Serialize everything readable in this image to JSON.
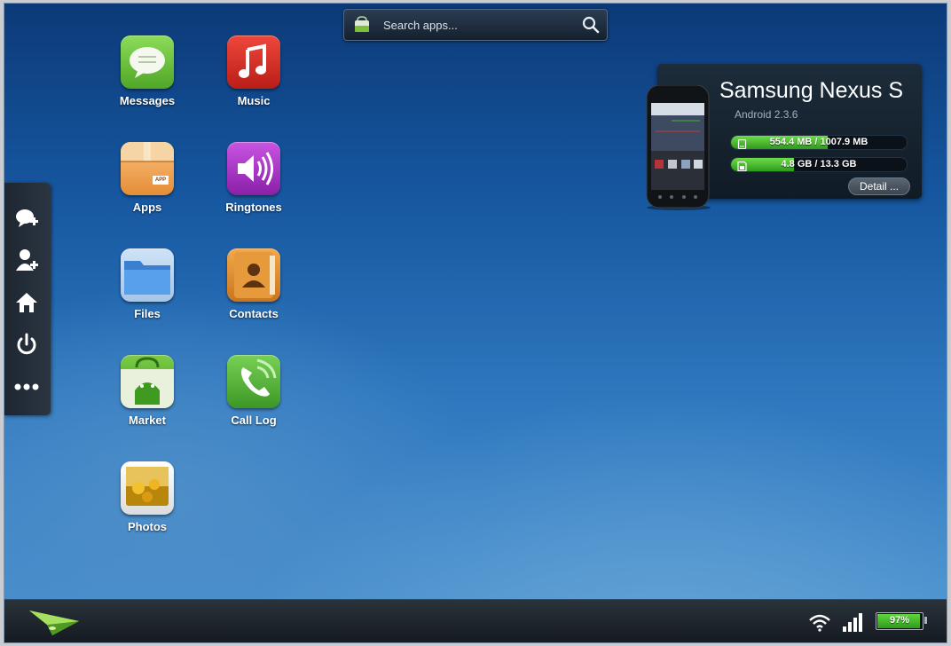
{
  "search": {
    "placeholder": "Search apps...",
    "bag_icon": "market-bag-icon",
    "search_icon": "magnifier-icon"
  },
  "apps": [
    {
      "label": "Messages",
      "icon": "messages-icon",
      "color": "#6cc43e"
    },
    {
      "label": "Music",
      "icon": "music-note-icon",
      "color": "#d8322a"
    },
    {
      "label": "Apps",
      "icon": "box-icon",
      "color": "#f0a557"
    },
    {
      "label": "Ringtones",
      "icon": "speaker-icon",
      "color": "#a935c7"
    },
    {
      "label": "Files",
      "icon": "folder-icon",
      "color": "#4a90e2"
    },
    {
      "label": "Contacts",
      "icon": "contacts-book-icon",
      "color": "#e08c2e"
    },
    {
      "label": "Market",
      "icon": "android-bag-icon",
      "color": "#61b331"
    },
    {
      "label": "Call Log",
      "icon": "phone-icon",
      "color": "#52b43a"
    },
    {
      "label": "Photos",
      "icon": "photo-icon",
      "color": "#f3f3f3"
    }
  ],
  "apps_box_badge": "APP",
  "dock": {
    "items": [
      {
        "icon": "new-message-icon"
      },
      {
        "icon": "add-contact-icon"
      },
      {
        "icon": "home-icon"
      },
      {
        "icon": "power-icon"
      },
      {
        "icon": "more-icon"
      }
    ]
  },
  "device": {
    "name": "Samsung Nexus S",
    "os": "Android 2.3.6",
    "storage": [
      {
        "label": "554.4 MB / 1007.9 MB",
        "used_fraction": 0.55,
        "icon": "phone-storage-icon"
      },
      {
        "label": "4.8 GB / 13.3 GB",
        "used_fraction": 0.36,
        "icon": "sd-card-icon"
      }
    ],
    "detail_label": "Detail ...",
    "accent_color": "#3fb82a"
  },
  "taskbar": {
    "logo_icon": "paper-plane-logo-icon",
    "wifi_icon": "wifi-icon",
    "signal_icon": "signal-bars-icon",
    "battery_label": "97%",
    "battery_fraction": 0.97
  }
}
